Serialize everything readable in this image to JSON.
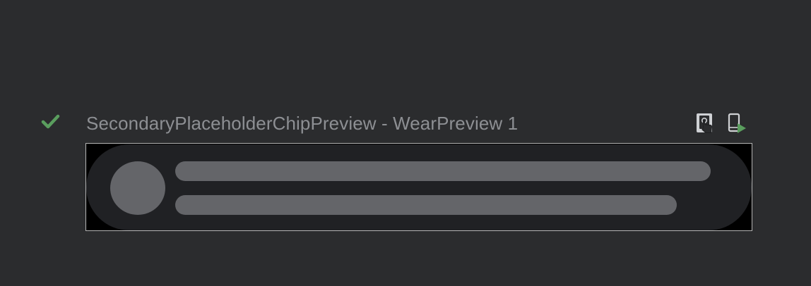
{
  "preview": {
    "status": "success",
    "status_icon": "checkmark-icon",
    "title": "SecondaryPlaceholderChipPreview - WearPreview 1"
  },
  "toolbar": {
    "buttons": [
      {
        "name": "interactive-mode",
        "icon": "touch-hand-icon"
      },
      {
        "name": "run-on-device",
        "icon": "device-run-icon"
      }
    ]
  },
  "colors": {
    "background": "#2b2c2e",
    "title_text": "#8d8f93",
    "success": "#5a9e5e",
    "chip_surface": "#202124",
    "placeholder": "#646569",
    "frame_border": "#b5b5b5"
  }
}
